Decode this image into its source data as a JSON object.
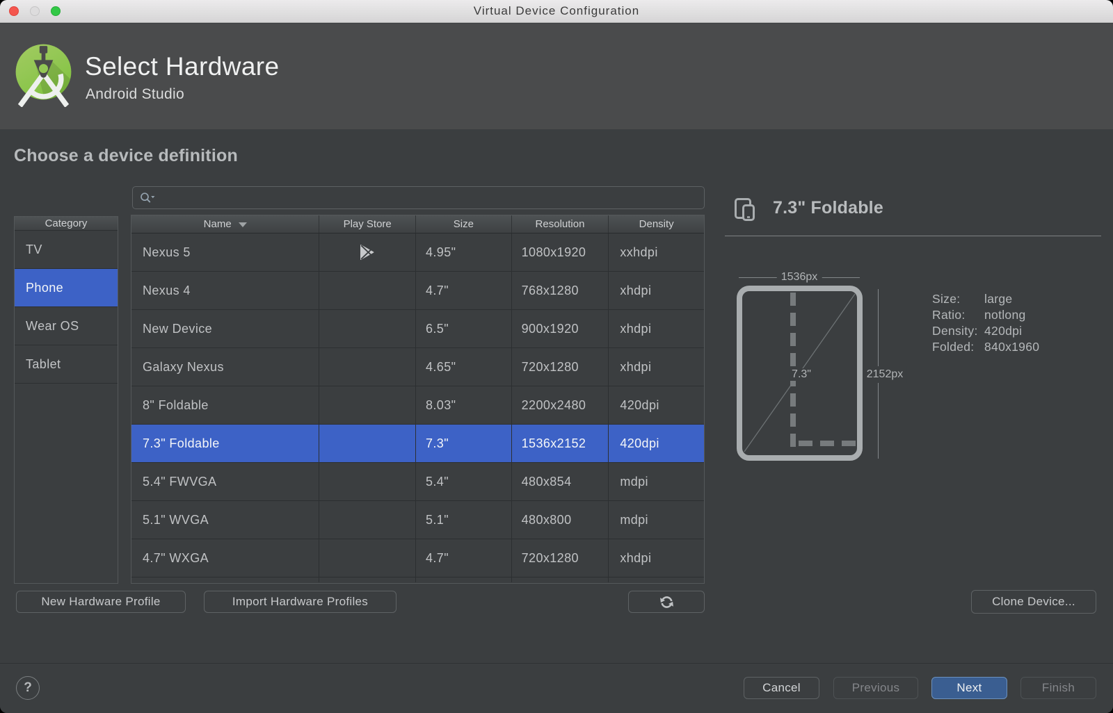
{
  "window": {
    "title": "Virtual Device Configuration"
  },
  "titlebar_controls": [
    "close",
    "minimize",
    "zoom"
  ],
  "header": {
    "title": "Select Hardware",
    "subtitle": "Android Studio"
  },
  "page": {
    "heading": "Choose a device definition"
  },
  "search": {
    "placeholder": "",
    "value": ""
  },
  "category": {
    "header": "Category",
    "items": [
      {
        "label": "TV",
        "selected": false
      },
      {
        "label": "Phone",
        "selected": true
      },
      {
        "label": "Wear OS",
        "selected": false
      },
      {
        "label": "Tablet",
        "selected": false
      }
    ]
  },
  "device_table": {
    "columns": [
      "Name",
      "Play Store",
      "Size",
      "Resolution",
      "Density"
    ],
    "sorted_column": "Name",
    "rows": [
      {
        "name": "Nexus 5",
        "play_store": true,
        "size": "4.95\"",
        "resolution": "1080x1920",
        "density": "xxhdpi",
        "selected": false
      },
      {
        "name": "Nexus 4",
        "play_store": false,
        "size": "4.7\"",
        "resolution": "768x1280",
        "density": "xhdpi",
        "selected": false
      },
      {
        "name": "New Device",
        "play_store": false,
        "size": "6.5\"",
        "resolution": "900x1920",
        "density": "xhdpi",
        "selected": false
      },
      {
        "name": "Galaxy Nexus",
        "play_store": false,
        "size": "4.65\"",
        "resolution": "720x1280",
        "density": "xhdpi",
        "selected": false
      },
      {
        "name": "8\" Foldable",
        "play_store": false,
        "size": "8.03\"",
        "resolution": "2200x2480",
        "density": "420dpi",
        "selected": false
      },
      {
        "name": "7.3\" Foldable",
        "play_store": false,
        "size": "7.3\"",
        "resolution": "1536x2152",
        "density": "420dpi",
        "selected": true
      },
      {
        "name": "5.4\" FWVGA",
        "play_store": false,
        "size": "5.4\"",
        "resolution": "480x854",
        "density": "mdpi",
        "selected": false
      },
      {
        "name": "5.1\" WVGA",
        "play_store": false,
        "size": "5.1\"",
        "resolution": "480x800",
        "density": "mdpi",
        "selected": false
      },
      {
        "name": "4.7\" WXGA",
        "play_store": false,
        "size": "4.7\"",
        "resolution": "720x1280",
        "density": "xhdpi",
        "selected": false
      }
    ]
  },
  "detail": {
    "title": "7.3\" Foldable",
    "diagram": {
      "width_label": "1536px",
      "height_label": "2152px",
      "diagonal_label": "7.3\""
    },
    "specs": [
      {
        "label": "Size:",
        "value": "large"
      },
      {
        "label": "Ratio:",
        "value": "notlong"
      },
      {
        "label": "Density:",
        "value": "420dpi"
      },
      {
        "label": "Folded:",
        "value": "840x1960"
      }
    ]
  },
  "actions": {
    "new_hardware_profile": "New Hardware Profile",
    "import_hardware_profiles": "Import Hardware Profiles",
    "refresh": "refresh-icon",
    "clone_device": "Clone Device..."
  },
  "footer": {
    "help": "?",
    "cancel": "Cancel",
    "previous": "Previous",
    "next": "Next",
    "finish": "Finish"
  },
  "colors": {
    "selection_blue": "#3d62c6",
    "primary_button_blue": "#3a5e91",
    "body_background": "#3b3e40",
    "header_background": "#4a4b4c"
  }
}
